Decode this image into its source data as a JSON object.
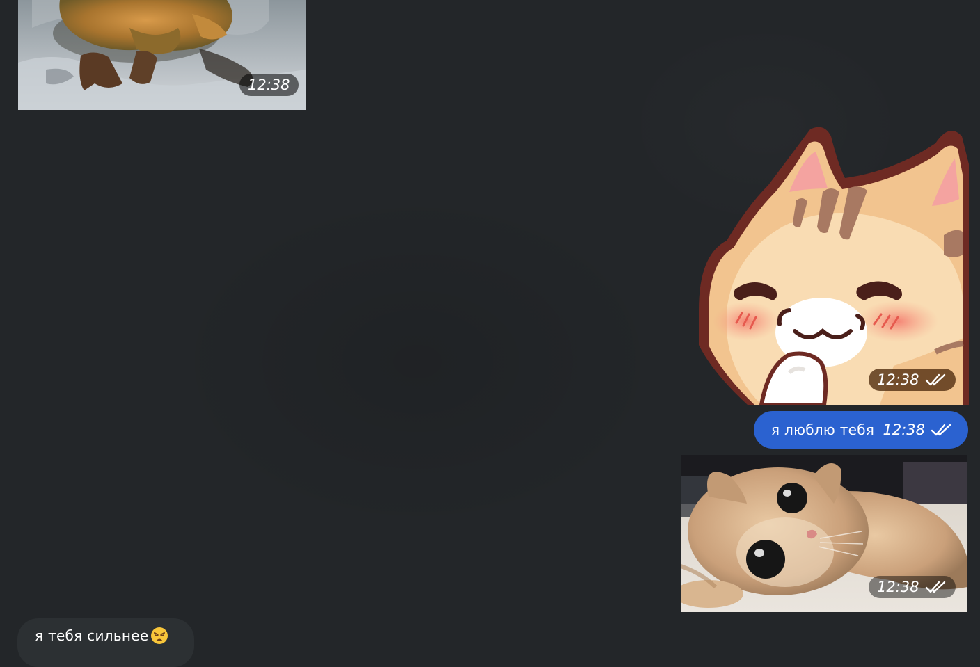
{
  "messages": [
    {
      "id": "photo-duck",
      "direction": "incoming",
      "type": "photo",
      "time": "12:38",
      "image": "duckling-on-snow"
    },
    {
      "id": "sticker-cat",
      "direction": "outgoing",
      "type": "sticker",
      "time": "12:38",
      "status": "read",
      "image": "blushing-cat-sticker"
    },
    {
      "id": "text-love",
      "direction": "outgoing",
      "type": "text",
      "text": "я люблю тебя",
      "time": "12:38",
      "status": "read"
    },
    {
      "id": "photo-kitten",
      "direction": "outgoing",
      "type": "photo",
      "time": "12:38",
      "status": "read",
      "image": "kitten-lying-on-rug"
    },
    {
      "id": "text-reply",
      "direction": "incoming",
      "type": "text",
      "text": "я тебя сильнее",
      "emoji": "weary-face"
    }
  ],
  "colors": {
    "background": "#232629",
    "outgoing_bubble": "#2b62d0",
    "incoming_bubble": "#2c3033"
  },
  "icons": {
    "read_status": "double-check-icon"
  }
}
